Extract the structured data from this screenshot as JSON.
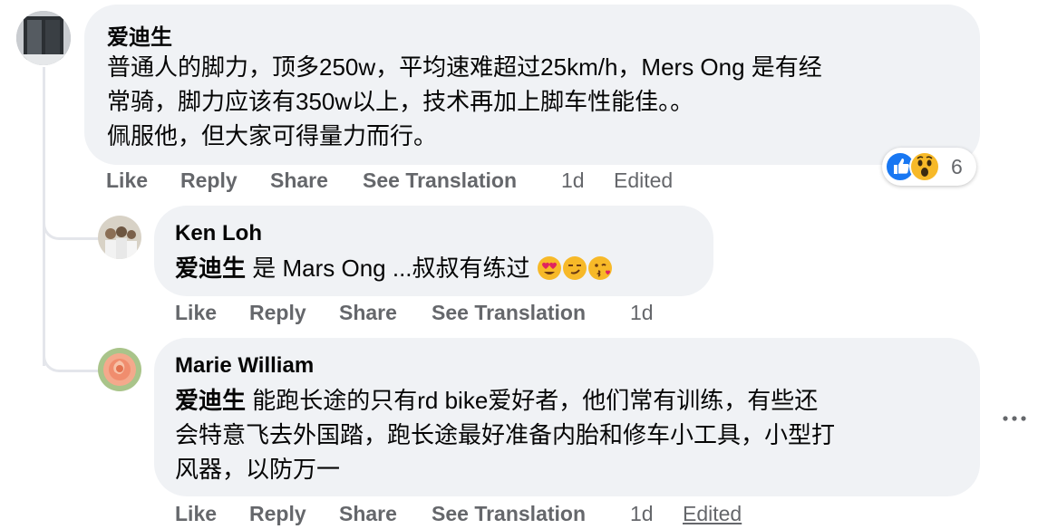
{
  "comments": [
    {
      "author": "爱迪生",
      "lines": [
        "普通人的脚力，顶多250w，平均速难超过25km/h，Mers Ong 是有经",
        "常骑，脚力应该有350w以上，技术再加上脚车性能佳。。",
        "佩服他，但大家可得量力而行。"
      ],
      "actions": {
        "like": "Like",
        "reply": "Reply",
        "share": "Share",
        "translate": "See Translation",
        "time": "1d",
        "edited": "Edited"
      },
      "reactions": {
        "icons": [
          "like-reaction-icon",
          "wow-reaction-icon"
        ],
        "count": "6"
      }
    },
    {
      "author": "Ken Loh",
      "mention": "爱迪生",
      "text": "是 Mars Ong ...叔叔有练过",
      "emojis": [
        "heart-eyes-emoji-icon",
        "smirk-emoji-icon",
        "kiss-emoji-icon"
      ],
      "actions": {
        "like": "Like",
        "reply": "Reply",
        "share": "Share",
        "translate": "See Translation",
        "time": "1d"
      }
    },
    {
      "author": "Marie William",
      "mention": "爱迪生",
      "line1": "能跑长途的只有rd bike爱好者，他们常有训练，有些还",
      "line2": "会特意飞去外国踏，跑长途最好准备内胎和修车小工具，小型打",
      "line3": "风器，以防万一",
      "actions": {
        "like": "Like",
        "reply": "Reply",
        "share": "Share",
        "translate": "See Translation",
        "time": "1d",
        "edited": "Edited"
      }
    }
  ],
  "more_icon": "more-options-icon",
  "colors": {
    "bubble": "#f0f2f5",
    "action_text": "#65676b",
    "like_blue": "#1877f2",
    "wow_yellow": "#f7b928"
  }
}
